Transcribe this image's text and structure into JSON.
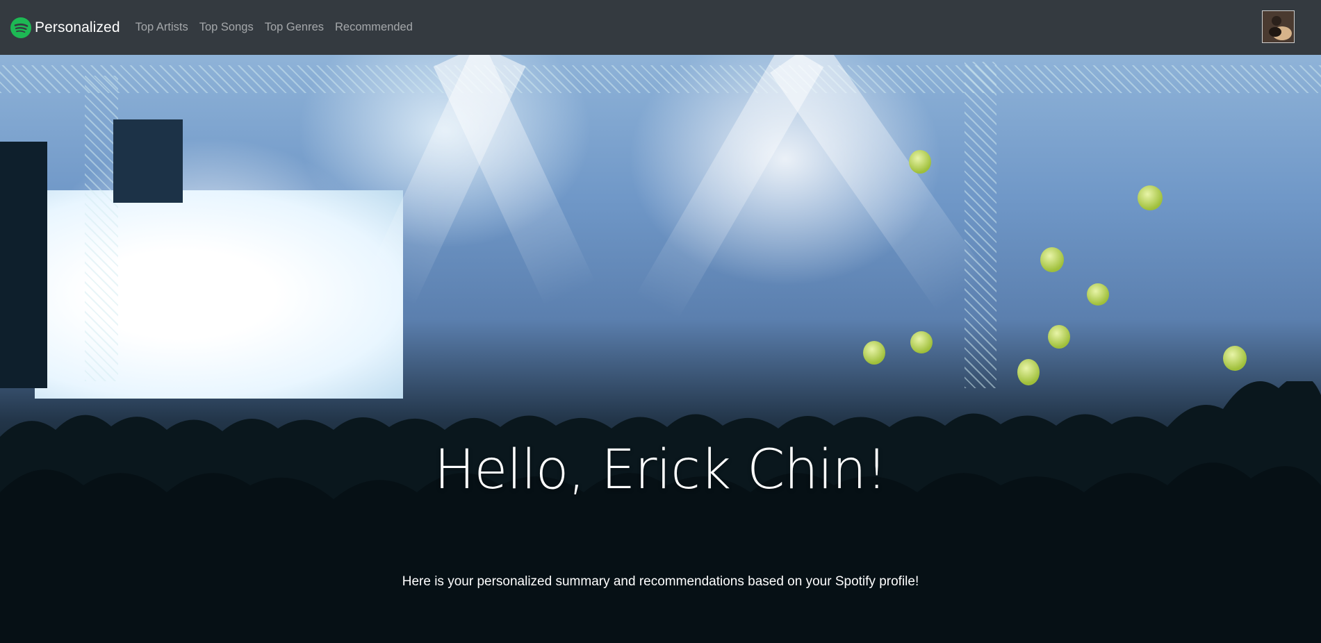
{
  "navbar": {
    "brand": "Personalized",
    "brand_icon": "spotify-logo-icon",
    "brand_color": "#1DB954",
    "background": "#343a40",
    "links": [
      {
        "label": "Top Artists"
      },
      {
        "label": "Top Songs"
      },
      {
        "label": "Top Genres"
      },
      {
        "label": "Recommended"
      }
    ],
    "avatar": "user-avatar"
  },
  "hero": {
    "title": "Hello, Erick Chin!",
    "subtitle": "Here is your personalized summary and recommendations based on your Spotify profile!",
    "background_image": "concert-crowd-photo"
  }
}
